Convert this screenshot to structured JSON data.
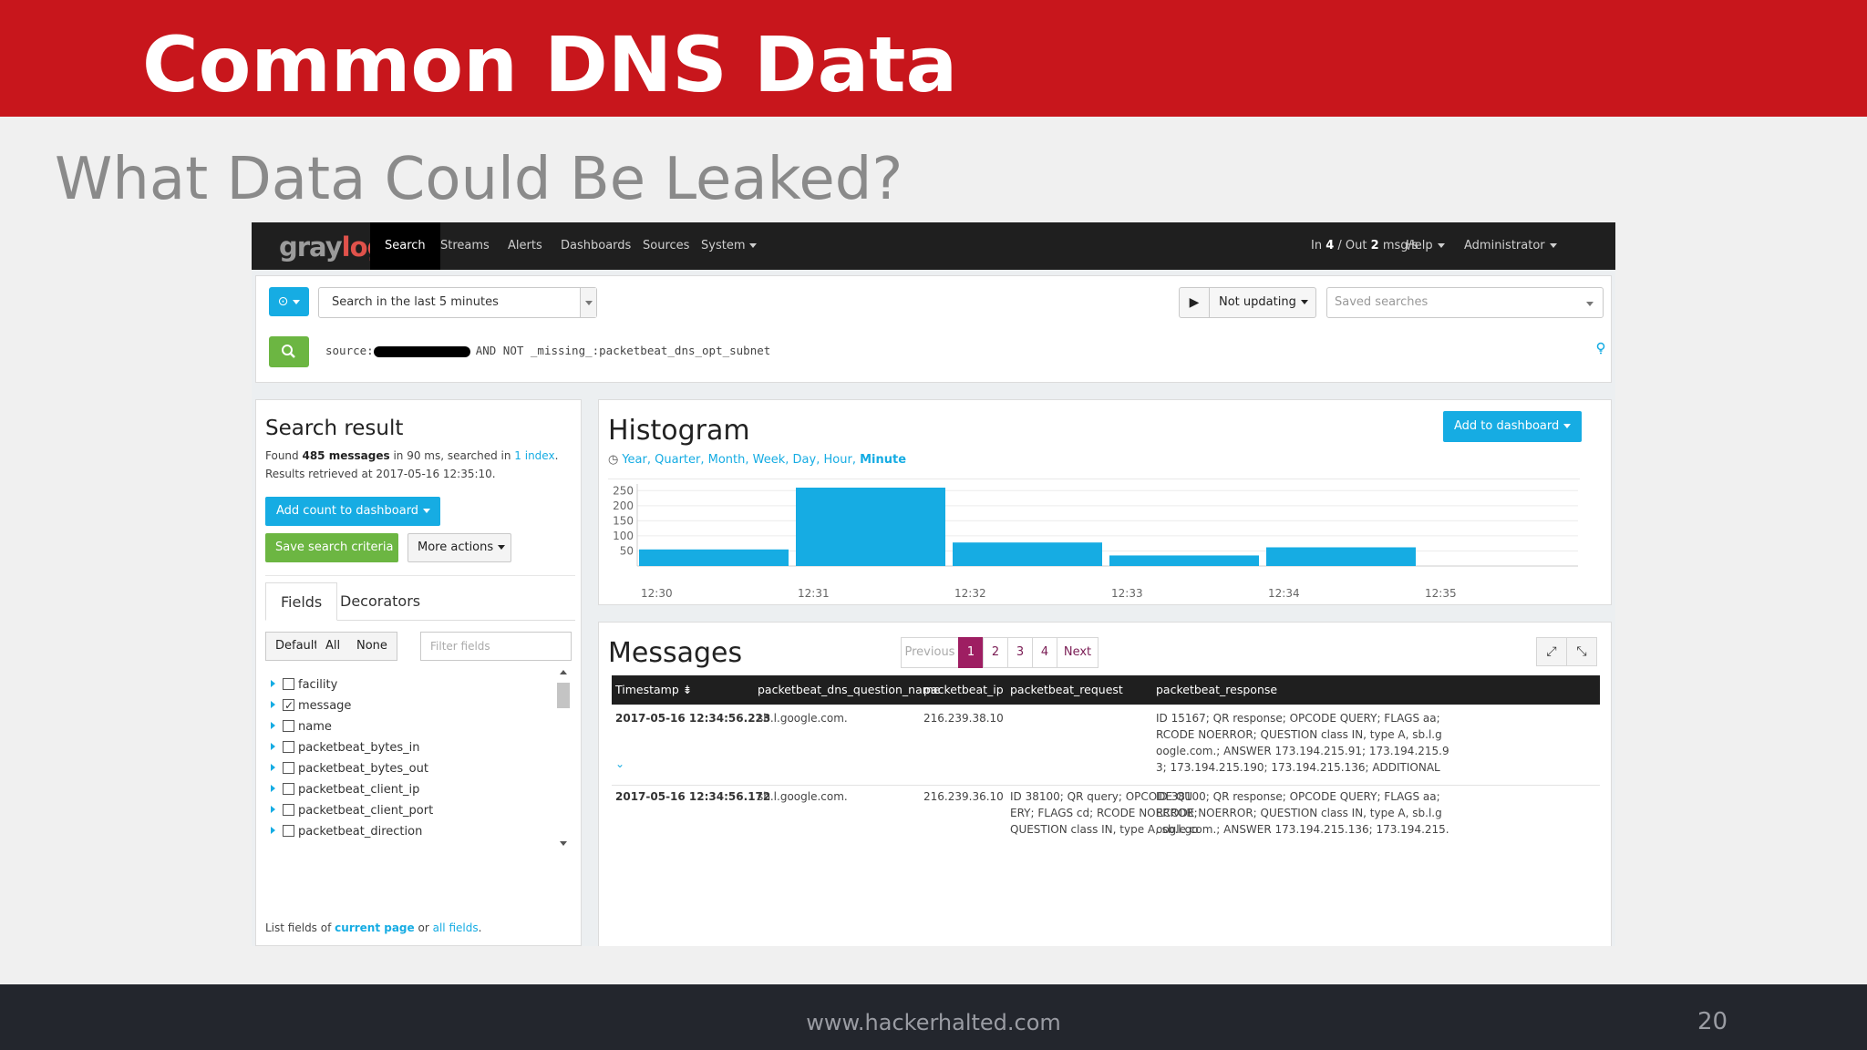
{
  "slide": {
    "title": "Common DNS Data",
    "subtitle": "What Data Could Be Leaked?",
    "footer_url": "www.hackerhalted.com",
    "page_number": "20",
    "header_color": "#c8161c"
  },
  "nav": {
    "logo_gray": "gray",
    "logo_log": "log",
    "items": [
      "Search",
      "Streams",
      "Alerts",
      "Dashboards",
      "Sources",
      "System"
    ],
    "throughput_in_label": "In",
    "throughput_in": "4",
    "throughput_sep": "/ Out",
    "throughput_out": "2",
    "throughput_unit": "msg/s",
    "help": "Help",
    "user": "Administrator"
  },
  "search": {
    "range": "Search in the last 5 minutes",
    "play_icon": "▶",
    "not_updating": "Not updating",
    "saved_searches_placeholder": "Saved searches",
    "query_prefix": "source:",
    "query_suffix": "AND NOT _missing_:packetbeat_dns_opt_subnet"
  },
  "result": {
    "title": "Search result",
    "found_prefix": "Found",
    "found_count": "485 messages",
    "found_mid": "in 90 ms, searched in",
    "found_index": "1 index",
    "found_end": ".",
    "retrieved": "Results retrieved at 2017-05-16 12:35:10.",
    "add_count": "Add count to dashboard",
    "save_search": "Save search criteria",
    "more_actions": "More actions",
    "tabs": [
      "Fields",
      "Decorators"
    ],
    "filter_buttons": [
      "Default",
      "All",
      "None"
    ],
    "filter_placeholder": "Filter fields",
    "fields": [
      {
        "name": "facility",
        "checked": false
      },
      {
        "name": "message",
        "checked": true
      },
      {
        "name": "name",
        "checked": false
      },
      {
        "name": "packetbeat_bytes_in",
        "checked": false
      },
      {
        "name": "packetbeat_bytes_out",
        "checked": false
      },
      {
        "name": "packetbeat_client_ip",
        "checked": false
      },
      {
        "name": "packetbeat_client_port",
        "checked": false
      },
      {
        "name": "packetbeat_direction",
        "checked": false
      }
    ],
    "list_prefix": "List fields of",
    "list_current": "current page",
    "list_or": "or",
    "list_all": "all fields",
    "list_end": "."
  },
  "histogram": {
    "title": "Histogram",
    "add_to_dashboard": "Add to dashboard",
    "resolutions": [
      "Year",
      "Quarter",
      "Month",
      "Week",
      "Day",
      "Hour",
      "Minute"
    ],
    "active_resolution": "Minute"
  },
  "chart_data": {
    "type": "bar",
    "categories": [
      "12:30",
      "12:31",
      "12:32",
      "12:33",
      "12:34",
      "12:35"
    ],
    "values": [
      55,
      260,
      78,
      35,
      62,
      0
    ],
    "yticks": [
      50,
      100,
      150,
      200,
      250
    ],
    "ylim": [
      0,
      260
    ],
    "color": "#16ace3",
    "grid": true
  },
  "messages": {
    "title": "Messages",
    "pagination": [
      "Previous",
      "1",
      "2",
      "3",
      "4",
      "Next"
    ],
    "active_page": "1",
    "columns": [
      "Timestamp",
      "packetbeat_dns_question_name",
      "packetbeat_ip",
      "packetbeat_request",
      "packetbeat_response"
    ],
    "rows": [
      {
        "timestamp": "2017-05-16 12:34:56.223",
        "question": "sb.l.google.com.",
        "ip": "216.239.38.10",
        "request": "",
        "response": [
          "ID 15167; QR response; OPCODE QUERY; FLAGS aa;",
          "RCODE NOERROR; QUESTION class IN, type A, sb.l.g",
          "oogle.com.; ANSWER 173.194.215.91; 173.194.215.9",
          "3; 173.194.215.190; 173.194.215.136; ADDITIONAL"
        ]
      },
      {
        "timestamp": "2017-05-16 12:34:56.172",
        "question": "sb.l.google.com.",
        "ip": "216.239.36.10",
        "request": [
          "ID 38100; QR query; OPCODE QU",
          "ERY; FLAGS cd; RCODE NOERROR;",
          "QUESTION class IN, type A, sb.l.go"
        ],
        "response": [
          "ID 38100; QR response; OPCODE QUERY; FLAGS aa;",
          "RCODE NOERROR; QUESTION class IN, type A, sb.l.g",
          "oogle.com.; ANSWER 173.194.215.136; 173.194.215."
        ]
      }
    ]
  }
}
